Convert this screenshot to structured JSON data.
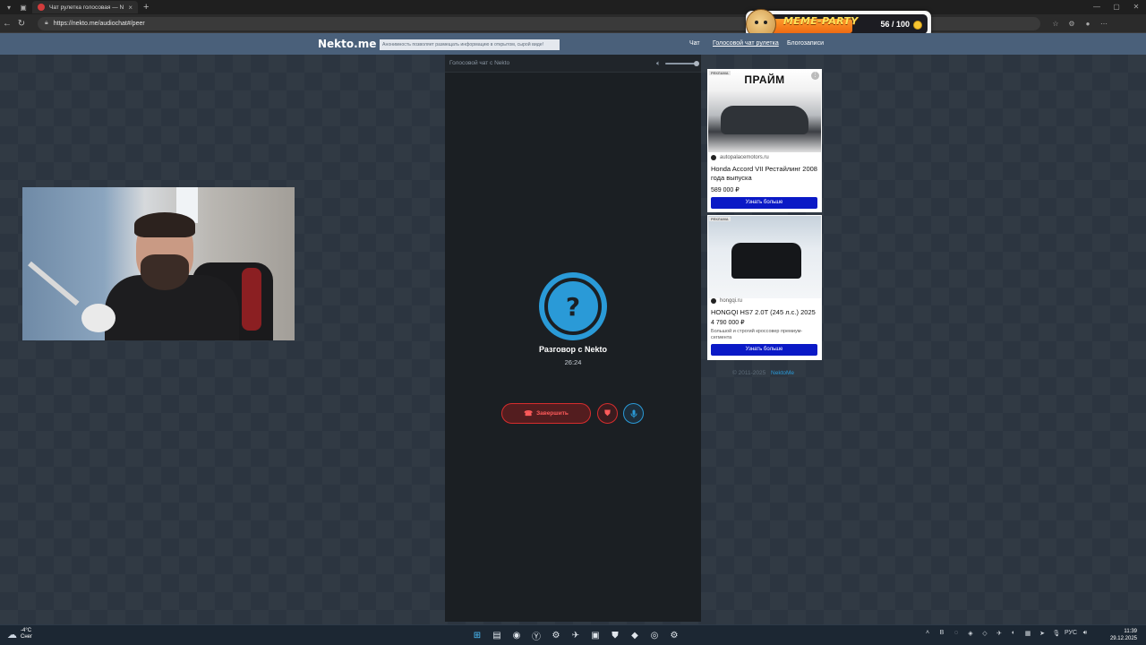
{
  "browser": {
    "tab_title": "Чат рулетка голосовая — N",
    "url": "https://nekto.me/audiochat#/peer",
    "new_tab_glyph": "+",
    "close_glyph": "×"
  },
  "overlay": {
    "label": "MEME-PARTY",
    "score": "56 / 100"
  },
  "site": {
    "logo": "Nekto.me",
    "notice": "Анонимность позволяет размещать информацию в открытом, сырой виде!",
    "nav": [
      "Чат",
      "Голосовой чат рулетка",
      "Блогозаписи"
    ]
  },
  "panel": {
    "title": "Голосовой чат с Nekto",
    "call_title": "Разговор с Nekto",
    "timer": "26:24",
    "end_label": "Завершить",
    "avatar_glyph": "?"
  },
  "ads": [
    {
      "tag": "РЕКЛАМА",
      "brand": "ПРАЙМ",
      "domain": "autopalacemotors.ru",
      "headline": "Honda Accord VII Рестайлинг 2008 года выпуска",
      "price": "589 000 ₽",
      "cta": "Узнать больше"
    },
    {
      "tag": "РЕКЛАМА",
      "domain": "hongqi.ru",
      "headline": "HONGQI HS7 2.0T (245 л.с.) 2025",
      "price": "4 790 000 ₽",
      "desc": "Большой и строгий кроссовер премиум-сегмента",
      "cta": "Узнать больше"
    }
  ],
  "footer": {
    "copyright": "© 2011-2025",
    "link": "NektoMe"
  },
  "taskbar": {
    "temp": "-4°C",
    "weather": "Снег",
    "lang": "РУС",
    "time": "11:39",
    "date": "29.12.2025"
  },
  "icons": {
    "avatar": "question-mark-icon",
    "end_call": "phone-hangup-icon",
    "report": "shield-icon",
    "mic": "microphone-icon",
    "volume": "speaker-icon"
  },
  "colors": {
    "accent": "#2a9ad7",
    "danger": "#d62d2d",
    "header": "#4a607a",
    "ad_cta": "#0a19c6"
  }
}
